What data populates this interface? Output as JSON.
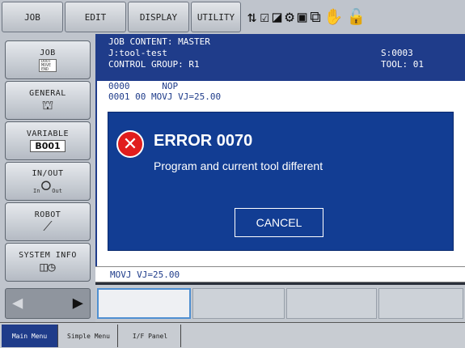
{
  "menubar": {
    "tabs": [
      "JOB",
      "EDIT",
      "DISPLAY",
      "UTILITY"
    ],
    "status_icons": [
      "coordinate-icon",
      "mode-icon",
      "cycle-icon",
      "run-status-icon",
      "servo-icon",
      "pause-icon",
      "hand-icon",
      "security-icon"
    ]
  },
  "sidebar": {
    "job_label": "JOB",
    "job_doc_lines": [
      "DOUT",
      "MOVE",
      "END"
    ],
    "general_label": "GENERAL",
    "variable_label": "VARIABLE",
    "variable_value": "B001",
    "inout_label": "IN/OUT",
    "inout_in": "In",
    "inout_out": "Out",
    "robot_label": "ROBOT",
    "sysinfo_label": "SYSTEM INFO"
  },
  "content": {
    "title": "JOB CONTENT: MASTER",
    "job_name": "J:tool-test",
    "step": "S:0003",
    "control_group": "CONTROL GROUP: R1",
    "tool": "TOOL: 01",
    "lines": [
      "0000      NOP",
      "0001 00 MOVJ VJ=25.00"
    ]
  },
  "dialog": {
    "title": "ERROR 0070",
    "message": "Program and current tool different",
    "cancel_label": "CANCEL",
    "error_color": "#e11d1d"
  },
  "input_line": "MOVJ VJ=25.00",
  "bottombar": {
    "tabs": [
      "Main Menu",
      "Simple Menu",
      "I/F Panel"
    ]
  },
  "colors": {
    "accent": "#1f3c8a",
    "dialog_bg": "#123d93",
    "highlight": "#4f8fd1"
  }
}
